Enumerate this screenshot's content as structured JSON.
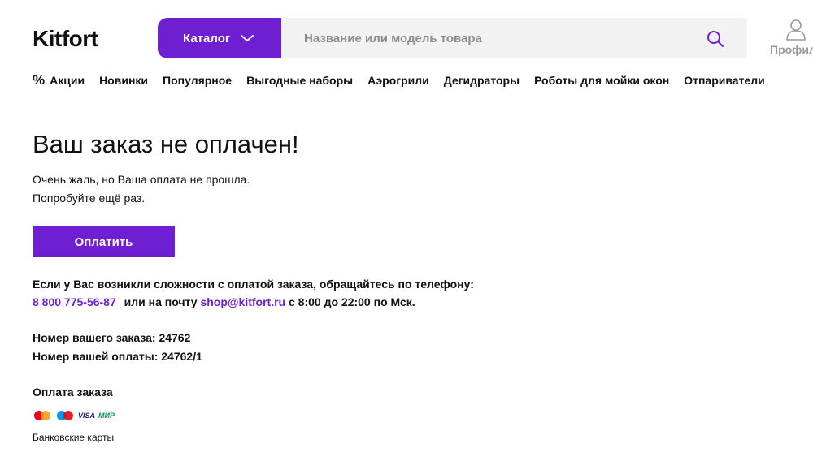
{
  "header": {
    "logo": "Kitfort",
    "catalog_label": "Каталог",
    "search_placeholder": "Название или модель товара",
    "profile_label": "Профиль"
  },
  "nav": {
    "items": [
      {
        "label": "Акции",
        "icon": "%"
      },
      {
        "label": "Новинки"
      },
      {
        "label": "Популярное"
      },
      {
        "label": "Выгодные наборы"
      },
      {
        "label": "Аэрогрили"
      },
      {
        "label": "Дегидраторы"
      },
      {
        "label": "Роботы для мойки окон"
      },
      {
        "label": "Отпариватели"
      }
    ]
  },
  "main": {
    "title": "Ваш заказ не оплачен!",
    "message_line1": "Очень жаль, но Ваша оплата не прошла.",
    "message_line2": "Попробуйте ещё раз.",
    "pay_button": "Оплатить",
    "contact_text": "Если у Вас возникли сложности с оплатой заказа, обращайтесь по телефону:",
    "phone": "8 800 775-56-87",
    "or_email_text": "или на почту",
    "email": "shop@kitfort.ru",
    "hours_text": "с 8:00 до 22:00 по Мск.",
    "order_number_label": "Номер вашего заказа: 24762",
    "payment_number_label": "Номер вашей оплаты: 24762/1",
    "payment_section_title": "Оплата заказа",
    "payment_methods": [
      "MasterCard",
      "Maestro",
      "VISA",
      "МИР"
    ],
    "cards_label": "Банковские карты"
  },
  "colors": {
    "accent": "#6f1fd2",
    "search_bg": "#f2f2f2",
    "muted": "#9a9a9a"
  }
}
